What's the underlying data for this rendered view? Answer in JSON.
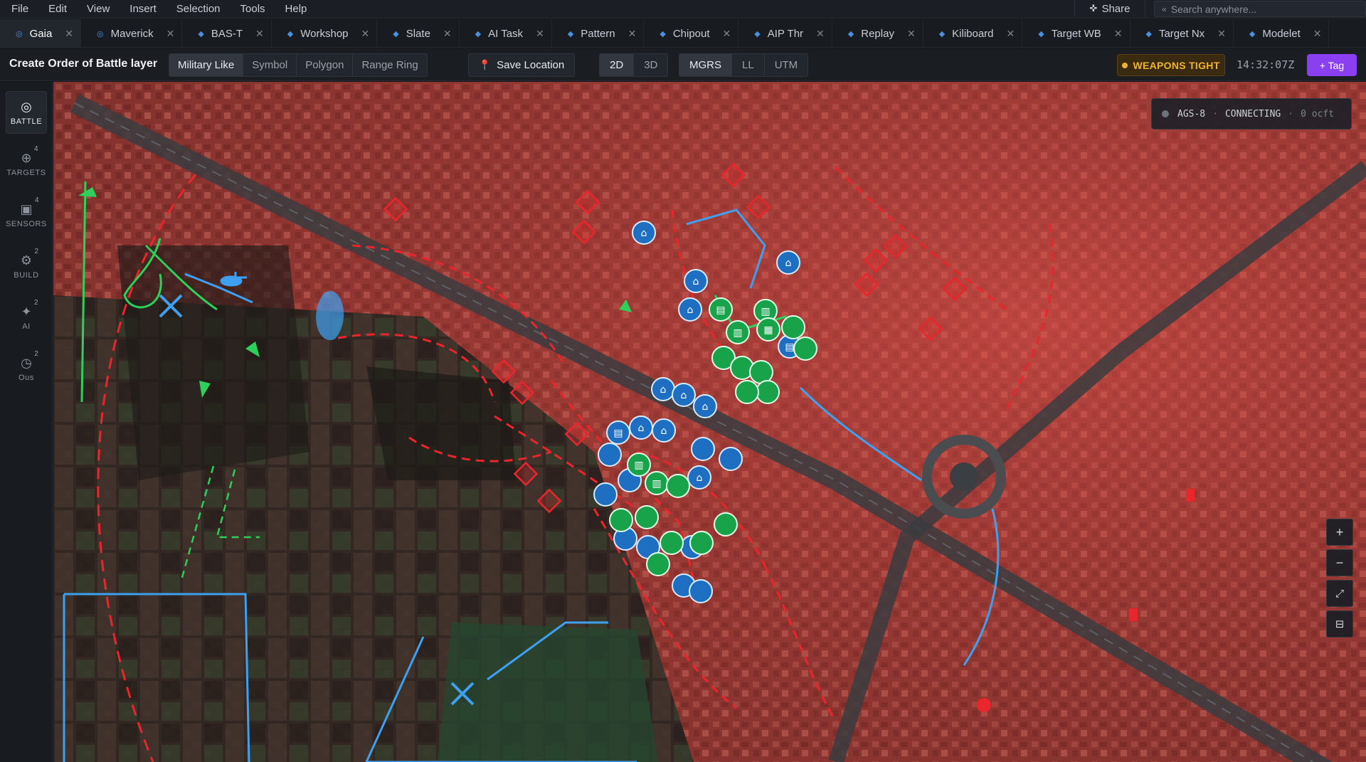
{
  "menu": [
    "File",
    "Edit",
    "View",
    "Insert",
    "Selection",
    "Tools",
    "Help"
  ],
  "share_label": "Share",
  "search_placeholder": "Search anywhere...",
  "tabs": [
    {
      "label": "Gaia",
      "active": true
    },
    {
      "label": "Maverick"
    },
    {
      "label": "BAS-T"
    },
    {
      "label": "Workshop"
    },
    {
      "label": "Slate"
    },
    {
      "label": "AI Task"
    },
    {
      "label": "Pattern"
    },
    {
      "label": "Chipout"
    },
    {
      "label": "AIP Thr"
    },
    {
      "label": "Replay"
    },
    {
      "label": "Kiliboard"
    },
    {
      "label": "Target WB"
    },
    {
      "label": "Target Nx"
    },
    {
      "label": "Modelet"
    }
  ],
  "toolbar": {
    "title": "Create Order of Battle layer",
    "layer_types": [
      "Military Like",
      "Symbol",
      "Polygon",
      "Range Ring"
    ],
    "save_location": "Save Location",
    "view_modes": [
      "2D",
      "3D"
    ],
    "coord_modes": [
      "MGRS",
      "LL",
      "UTM"
    ],
    "weapons_status": "WEAPONS TIGHT",
    "clock": "14:32:07Z",
    "tag_button": "+ Tag"
  },
  "rail": [
    {
      "label": "BATTLE",
      "count": "",
      "icon": "globe-icon"
    },
    {
      "label": "TARGETS",
      "count": "4",
      "icon": "crosshair-icon"
    },
    {
      "label": "SENSORS",
      "count": "4",
      "icon": "sensor-icon"
    },
    {
      "label": "BUILD",
      "count": "2",
      "icon": "build-icon"
    },
    {
      "label": "AI",
      "count": "2",
      "icon": "sparkle-icon"
    },
    {
      "label": "Ous",
      "count": "2",
      "icon": "clock-icon"
    }
  ],
  "sensor_status": {
    "id": "AGS-8",
    "state": "CONNECTING",
    "rate": "0 ocft"
  },
  "zoom_controls": [
    "+",
    "−",
    "⤢",
    "⊟"
  ],
  "colors": {
    "hostile": "#e8262c",
    "friendly": "#3fa0f0",
    "neutral": "#2dd05a",
    "accent": "#8a3ff0",
    "warning": "#f0b429"
  }
}
